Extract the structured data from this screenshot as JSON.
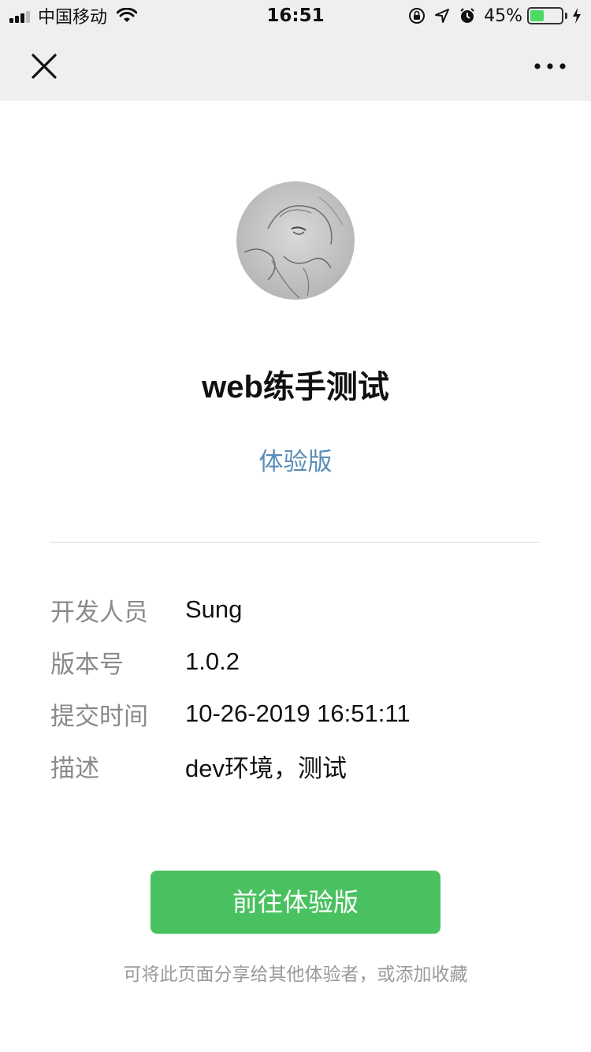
{
  "status_bar": {
    "carrier": "中国移动",
    "time": "16:51",
    "battery_percent_label": "45%",
    "battery_level": 0.45
  },
  "nav": {
    "close_icon": "close-icon",
    "more_icon": "more-icon"
  },
  "app": {
    "name": "web练手测试",
    "version_type": "体验版"
  },
  "info": {
    "developer": {
      "label": "开发人员",
      "value": "Sung"
    },
    "version": {
      "label": "版本号",
      "value": "1.0.2"
    },
    "submit_time": {
      "label": "提交时间",
      "value": "10-26-2019 16:51:11"
    },
    "description": {
      "label": "描述",
      "value": "dev环境，测试"
    }
  },
  "cta": {
    "label": "前往体验版"
  },
  "hint": "可将此页面分享给其他体验者，或添加收藏",
  "colors": {
    "accent_green": "#4ac160",
    "link_blue": "#5b8cb7",
    "nav_bg": "#efefef"
  }
}
